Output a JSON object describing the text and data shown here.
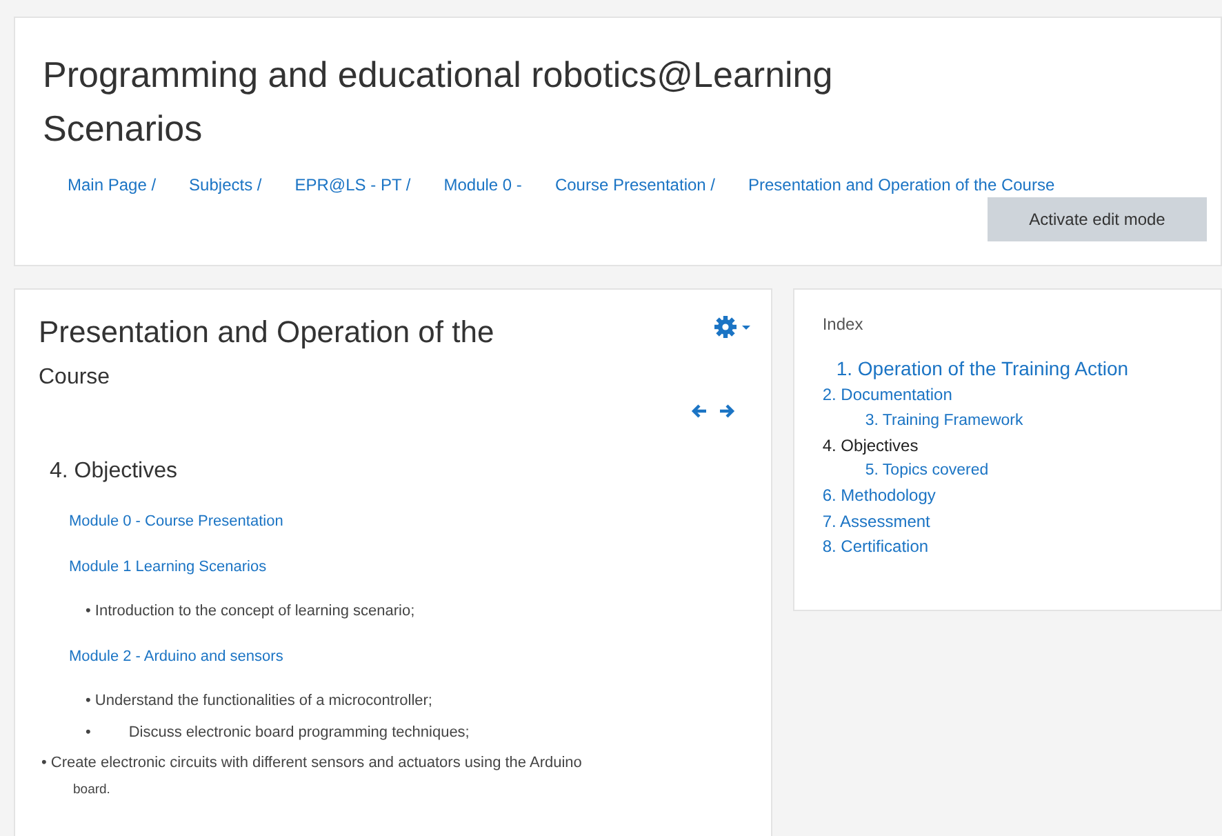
{
  "header": {
    "title": "Programming and educational robotics@Learning Scenarios",
    "breadcrumb": [
      "Main Page /",
      "Subjects /",
      "EPR@LS - PT /",
      "Module 0 -",
      "Course Presentation /",
      "Presentation and Operation of the Course"
    ],
    "edit_button": "Activate edit mode"
  },
  "content": {
    "title": "Presentation and Operation of the",
    "subtitle": "Course",
    "section": "4. Objectives",
    "lines": [
      {
        "kind": "module",
        "text": "Module 0 - Course Presentation"
      },
      {
        "kind": "module",
        "text": "Module 1 Learning Scenarios"
      },
      {
        "kind": "bullet",
        "text": "• Introduction to the concept of learning scenario;"
      },
      {
        "kind": "module",
        "text": "Module 2 - Arduino and sensors"
      },
      {
        "kind": "bullet",
        "text": "• Understand the functionalities of a microcontroller;"
      },
      {
        "kind": "bullet",
        "text": "•         Discuss electronic board programming techniques;"
      },
      {
        "kind": "bullet",
        "text": "• Create electronic circuits with different sensors and actuators using the Arduino"
      },
      {
        "kind": "note",
        "text": "board."
      }
    ]
  },
  "index": {
    "title": "Index",
    "items": [
      {
        "text": "1. Operation of the Training Action",
        "selected": false
      },
      {
        "text": "2. Documentation",
        "selected": false,
        "children": [
          {
            "text": "3. Training Framework",
            "selected": false
          }
        ]
      },
      {
        "text": "4. Objectives",
        "selected": true,
        "children": [
          {
            "text": "5. Topics covered",
            "selected": false
          }
        ]
      },
      {
        "text": "6. Methodology",
        "selected": false
      },
      {
        "text": "7. Assessment",
        "selected": false
      },
      {
        "text": "8. Certification",
        "selected": false
      }
    ]
  }
}
